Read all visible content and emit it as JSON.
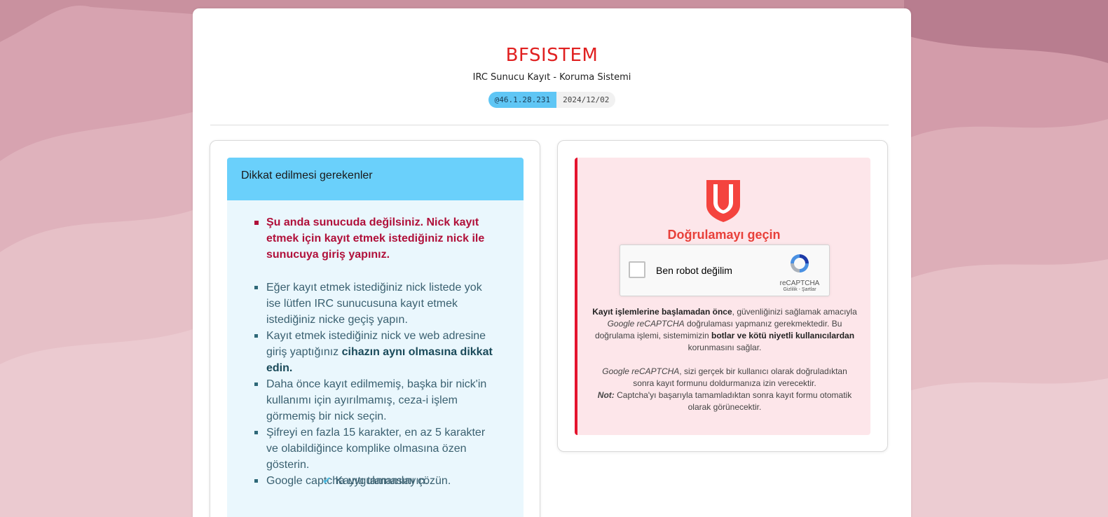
{
  "header": {
    "title": "BFSISTEM",
    "subtitle": "IRC Sunucu Kayıt - Koruma Sistemi",
    "ip": "@46.1.28.231",
    "date": "2024/12/02"
  },
  "notice": {
    "heading": "Dikkat edilmesi gerekenler",
    "warning": "Şu anda sunucuda değilsiniz. Nick kayıt etmek için kayıt etmek istediğiniz nick ile sunucuya giriş yapınız.",
    "rules": [
      {
        "text": "Eğer kayıt etmek istediğiniz nick listede yok ise lütfen IRC sunucusuna kayıt etmek istediğiniz nicke geçiş yapın."
      },
      {
        "text_before": "Kayıt etmek istediğiniz nick ve web adresine giriş yaptığınız ",
        "text_strong": "cihazın aynı olmasına dikkat edin."
      },
      {
        "text": "Daha önce kayıt edilmemiş, başka bir nick'in kullanımı için ayırılmamış, ceza-i işlem görmemiş bir nick seçin."
      },
      {
        "text": "Şifreyi en fazla 15 karakter, en az 5 karakter ve olabildiğince komplike olmasına özen gösterin."
      },
      {
        "text": "Google captcha uygulamasını çözün."
      }
    ],
    "complete_label": "Kayıtı tamamlayın."
  },
  "verify": {
    "title": "Doğrulamayı geçin",
    "recaptcha": {
      "label": "Ben robot değilim",
      "brand": "reCAPTCHA",
      "links": "Gizlilik - Şartlar",
      "checked": false
    },
    "p1": {
      "b1": "Kayıt işlemlerine başlamadan önce",
      "t1": ", güvenliğinizi sağlamak amacıyla ",
      "i1": "Google reCAPTCHA",
      "t2": " doğrulaması yapmanız gerekmektedir. Bu doğrulama işlemi, sistemimizin ",
      "b2": "botlar ve kötü niyetli kullanıcılardan",
      "t3": " korunmasını sağlar."
    },
    "p2": {
      "i1": "Google reCAPTCHA",
      "t1": ", sizi gerçek bir kullanıcı olarak doğruladıktan sonra kayıt formunu doldurmanıza izin verecektir."
    },
    "p3": {
      "b1": "Not:",
      "t1": " Captcha'yı başarıyla tamamladıktan sonra kayıt formu otomatik olarak görünecektir."
    }
  },
  "colors": {
    "accent_red": "#e02020",
    "info_head": "#6ad0fb",
    "warning_text": "#b0103a",
    "verify_bg": "#fde6ea"
  }
}
